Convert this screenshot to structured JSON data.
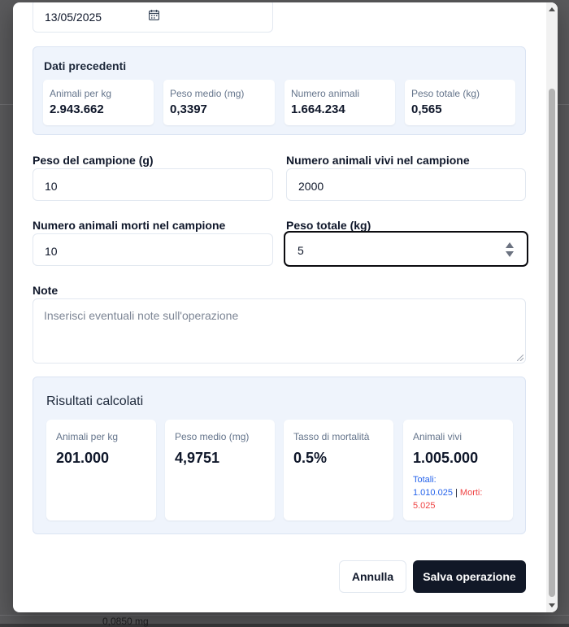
{
  "background": {
    "fragment_text": "0,0850 mg"
  },
  "form": {
    "date_value": "13/05/2025",
    "previous": {
      "title": "Dati precedenti",
      "stats": [
        {
          "label": "Animali per kg",
          "value": "2.943.662"
        },
        {
          "label": "Peso medio (mg)",
          "value": "0,3397"
        },
        {
          "label": "Numero animali",
          "value": "1.664.234"
        },
        {
          "label": "Peso totale (kg)",
          "value": "0,565"
        }
      ]
    },
    "sample_weight": {
      "label": "Peso del campione (g)",
      "value": "10"
    },
    "live_animals": {
      "label": "Numero animali vivi nel campione",
      "value": "2000"
    },
    "dead_animals": {
      "label": "Numero animali morti nel campione",
      "value": "10"
    },
    "total_weight": {
      "label": "Peso totale (kg)",
      "value": "5"
    },
    "notes": {
      "label": "Note",
      "placeholder": "Inserisci eventuali note sull'operazione"
    },
    "results": {
      "title": "Risultati calcolati",
      "cards": [
        {
          "label": "Animali per kg",
          "value": "201.000"
        },
        {
          "label": "Peso medio (mg)",
          "value": "4,9751"
        },
        {
          "label": "Tasso di mortalità",
          "value": "0.5%"
        },
        {
          "label": "Animali vivi",
          "value": "1.005.000"
        }
      ],
      "totals_label": "Totali:",
      "totals_value": "1.010.025",
      "separator": "|",
      "dead_label": "Morti:",
      "dead_value": "5.025"
    },
    "buttons": {
      "cancel": "Annulla",
      "save": "Salva operazione"
    }
  },
  "colors": {
    "primary": "#111827",
    "accent_blue": "#2563eb",
    "danger": "#ef4444",
    "panel_bg": "#eff4fc"
  }
}
